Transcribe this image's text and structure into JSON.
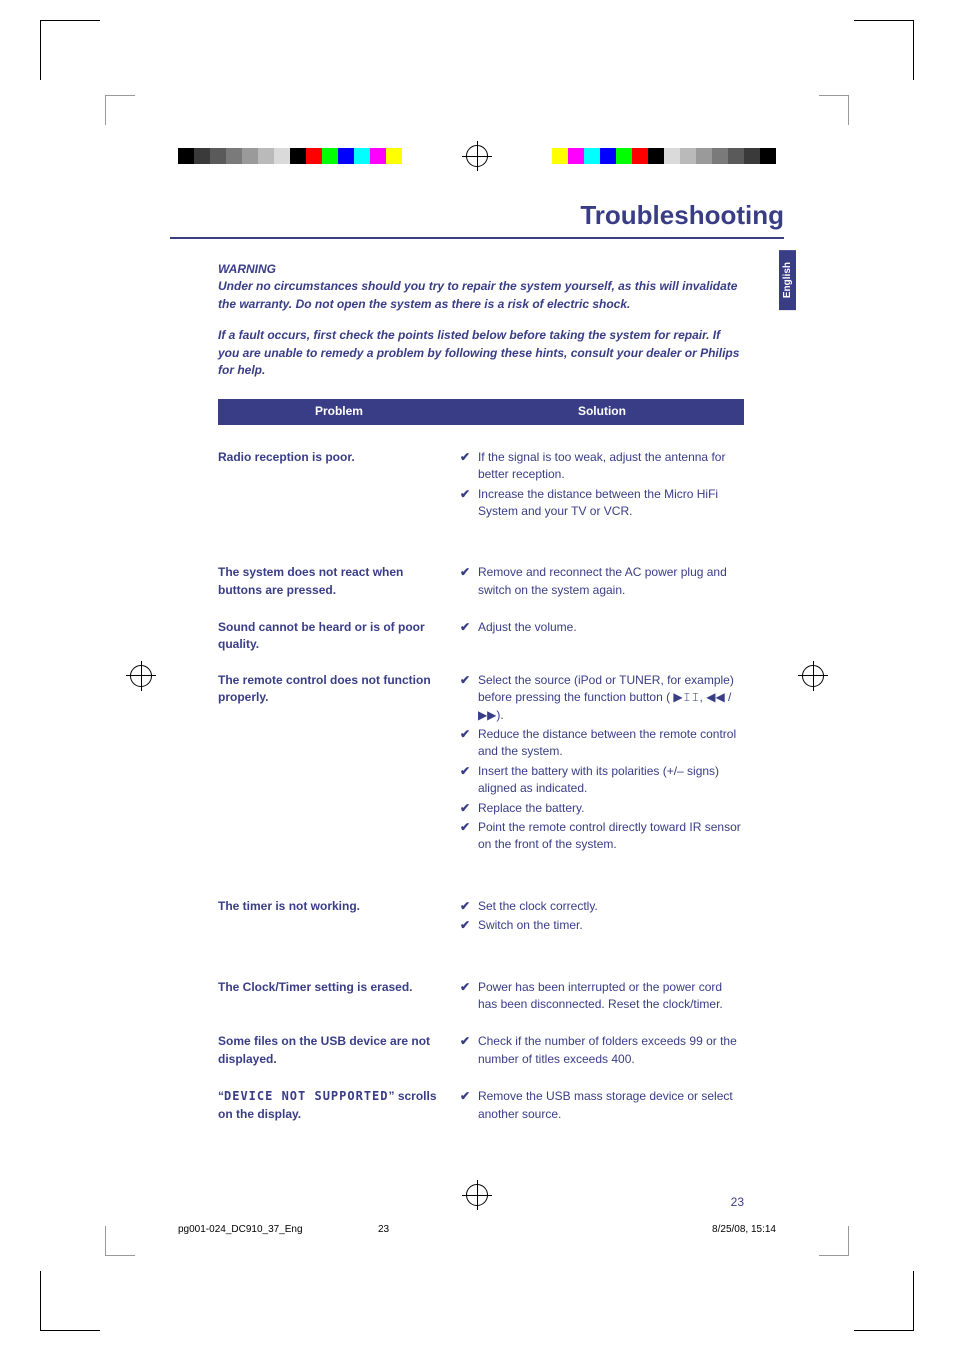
{
  "header": {
    "title": "Troubleshooting",
    "language_tab": "English"
  },
  "warning": {
    "heading": "WARNING",
    "line1": "Under no circumstances should you try to repair the system yourself, as this will invalidate the warranty.  Do not open the system as there is a risk of electric shock.",
    "line2": "If a fault occurs, first check the points listed below before taking the system for repair. If you are unable to remedy a problem by following these hints, consult your dealer or Philips for help."
  },
  "table_header": {
    "problem": "Problem",
    "solution": "Solution"
  },
  "rows": [
    {
      "problem": "Radio reception is poor.",
      "solutions": [
        "If the signal is too weak, adjust the antenna for better reception.",
        "Increase the distance between the Micro HiFi System and your TV or VCR."
      ]
    },
    {
      "problem": "The system does not react when buttons are pressed.",
      "solutions": [
        "Remove and reconnect the AC power plug and switch on the system again."
      ]
    },
    {
      "problem": "Sound cannot be heard or is of poor quality.",
      "solutions": [
        "Adjust the volume."
      ]
    },
    {
      "problem": "The remote control does not function properly.",
      "solutions": [
        "Select the source (iPod or TUNER, for example) before pressing the function button ( ▶𝙸𝙸, ◀◀ / ▶▶).",
        "Reduce the distance between the remote control and the system.",
        "Insert the battery with its polarities (+/– signs) aligned as indicated.",
        "Replace the battery.",
        "Point the remote control directly toward IR sensor on the front of the system."
      ]
    },
    {
      "problem": "The timer is not working.",
      "solutions": [
        "Set the clock correctly.",
        "Switch on the timer."
      ]
    },
    {
      "problem": "The Clock/Timer setting is erased.",
      "solutions": [
        "Power has been interrupted or the power cord has been disconnected. Reset the clock/timer."
      ]
    },
    {
      "problem": "Some files on the USB device are not displayed.",
      "solutions": [
        "Check if the number of folders exceeds 99 or the number of titles exceeds 400."
      ]
    },
    {
      "problem_prefix": "“",
      "problem_lcd": "DEVICE NOT SUPPORTED",
      "problem_suffix": "” scrolls on the display.",
      "solutions": [
        "Remove the USB mass storage device or select another source."
      ]
    }
  ],
  "page_number": "23",
  "footer": {
    "filename": "pg001-024_DC910_37_Eng",
    "page": "23",
    "datetime": "8/25/08, 15:14"
  },
  "colorbar_colors": [
    "#000",
    "#3a3a3a",
    "#5a5a5a",
    "#7a7a7a",
    "#9a9a9a",
    "#bababa",
    "#dadada",
    "#000",
    "#f00",
    "#0f0",
    "#00f",
    "#0ff",
    "#f0f",
    "#ff0"
  ]
}
